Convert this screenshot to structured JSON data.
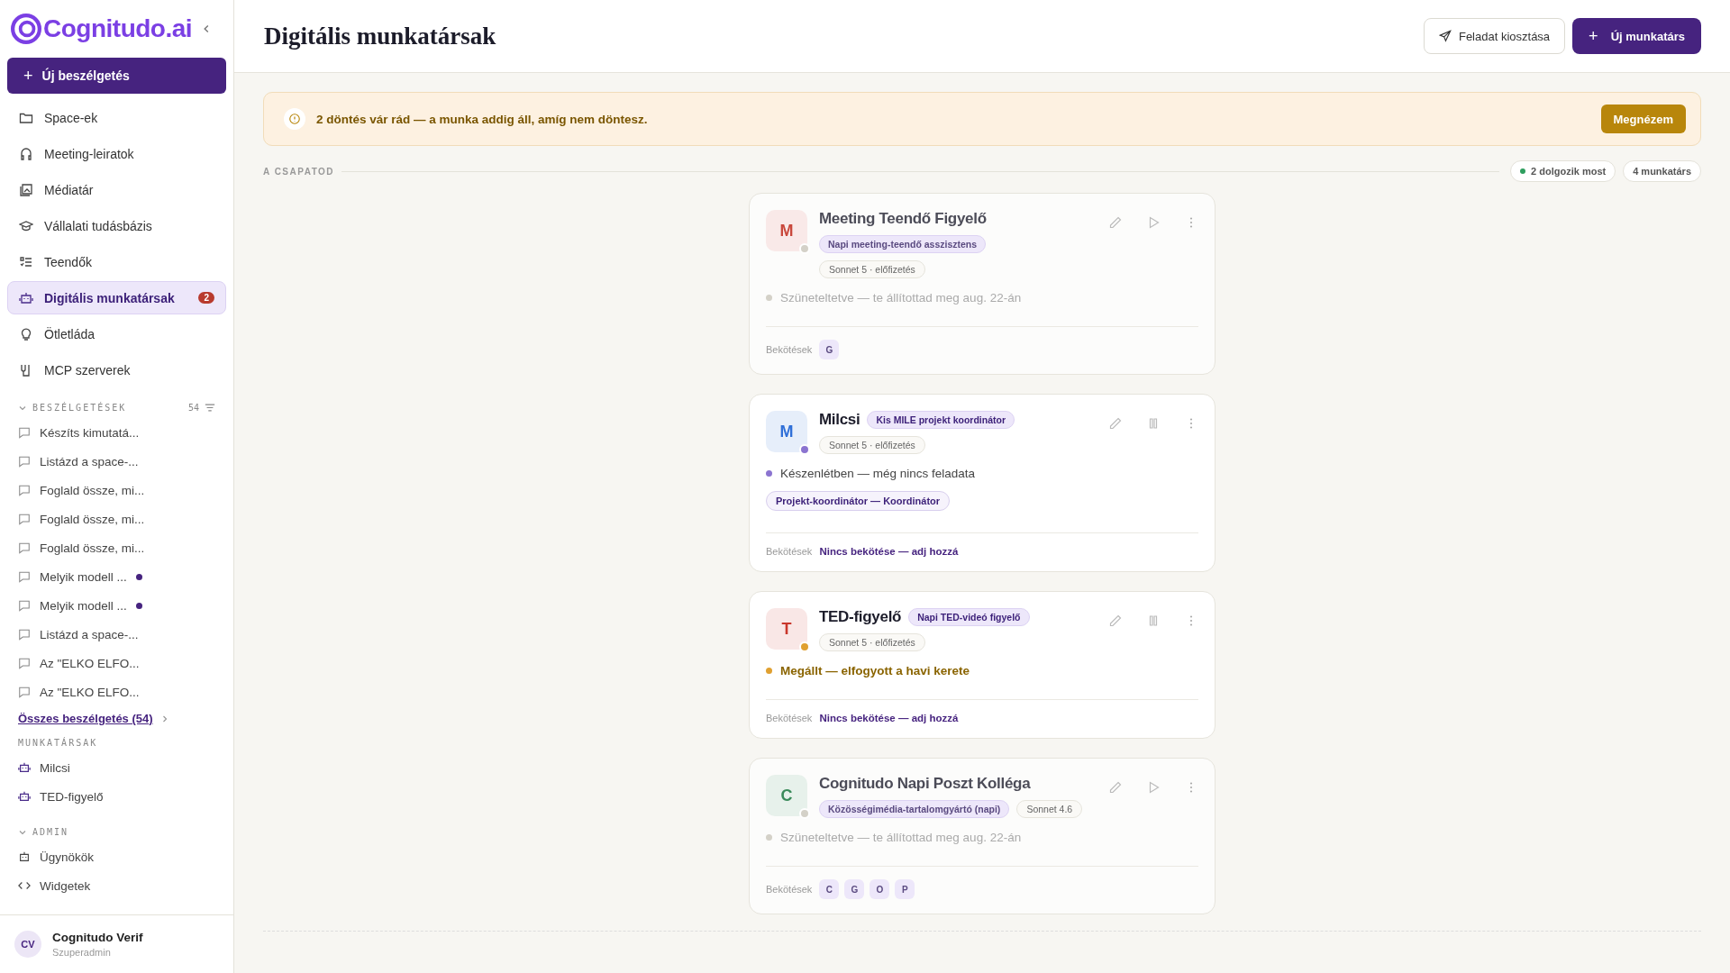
{
  "sidebar": {
    "brand": "Cognitudo.ai",
    "new_chat": "Új beszélgetés",
    "nav": [
      {
        "label": "Space-ek",
        "selected": false
      },
      {
        "label": "Meeting-leiratok",
        "selected": false
      },
      {
        "label": "Médiatár",
        "selected": false
      },
      {
        "label": "Vállalati tudásbázis",
        "selected": false
      },
      {
        "label": "Teendők",
        "selected": false
      },
      {
        "label": "Digitális munkatársak",
        "selected": true,
        "badge": "2"
      },
      {
        "label": "Ötletláda",
        "selected": false
      },
      {
        "label": "MCP szerverek",
        "selected": false
      }
    ],
    "conversations": {
      "title": "BESZÉLGETÉSEK",
      "count": "54",
      "expanded": true,
      "items": [
        {
          "label": "Készíts kimutatá...",
          "unread": false
        },
        {
          "label": "Listázd a space-...",
          "unread": false
        },
        {
          "label": "Foglald össze, mi...",
          "unread": false
        },
        {
          "label": "Foglald össze, mi...",
          "unread": false
        },
        {
          "label": "Foglald össze, mi...",
          "unread": false
        },
        {
          "label": "Melyik modell ...",
          "unread": true
        },
        {
          "label": "Melyik modell ...",
          "unread": true
        },
        {
          "label": "Listázd a space-...",
          "unread": false
        },
        {
          "label": "Az \"ELKO ELFO...",
          "unread": false
        },
        {
          "label": "Az \"ELKO ELFO...",
          "unread": false
        }
      ],
      "all_link": "Összes beszélgetés (54)"
    },
    "new_chat_icon": "+",
    "coworkers": {
      "title": "MUNKATÁRSAK",
      "items": [
        "Milcsi",
        "TED-figyelő"
      ]
    },
    "admin": {
      "title": "ADMIN",
      "expanded": true,
      "items": [
        {
          "label": "Ügynökök"
        },
        {
          "label": "Widgetek"
        }
      ]
    },
    "user": {
      "initials": "CV",
      "name": "Cognitudo Verif",
      "role": "Szuperadmin"
    }
  },
  "header": {
    "title": "Digitális munkatársak",
    "assign_button": "Feladat kiosztása",
    "new_icon": "+",
    "new_button": "Új munkatárs"
  },
  "alert": {
    "text": "2 döntés vár rád — a munka addig áll, amíg nem döntesz.",
    "button": "Megnézem"
  },
  "team": {
    "title": "A CSAPATOD",
    "working": "2 dolgozik most",
    "total": "4 munkatárs",
    "cards": [
      {
        "kind": "stacked",
        "avatar": {
          "initial": "M",
          "color": "#c9483c"
        },
        "name": "Meeting Teendő Figyelő",
        "paused": true,
        "role": "Napi meeting-teendő asszisztens",
        "models": [
          "Sonnet 5 · előfizetés"
        ],
        "status": {
          "kind": "paused",
          "color": "#d4d1c8",
          "text": "Szüneteltetve — te állítottad meg aug. 22-án"
        },
        "bindings_label": "Bekötések",
        "bindings": [
          "G"
        ]
      },
      {
        "kind": "inline",
        "avatar": {
          "initial": "M",
          "color": "#2f6fd8"
        },
        "name": "Milcsi",
        "paused": false,
        "role": "Kis MILE projekt koordinátor",
        "models": [
          "Sonnet 5 · előfizetés"
        ],
        "status": {
          "kind": "idle",
          "color": "#8b74d0",
          "text": "Készenlétben — még nincs feladata"
        },
        "skill": "Projekt-koordinátor — Koordinátor",
        "bindings_label": "Bekötések",
        "bindings_link": "Nincs bekötése — adj hozzá"
      },
      {
        "kind": "inline",
        "avatar": {
          "initial": "T",
          "color": "#c9372c"
        },
        "name": "TED-figyelő",
        "paused": false,
        "role": "Napi TED-videó figyelő",
        "models": [
          "Sonnet 5 · előfizetés"
        ],
        "status": {
          "kind": "stopped",
          "color": "#e0a030",
          "text": "Megállt — elfogyott a havi kerete"
        },
        "bindings_label": "Bekötések",
        "bindings_link": "Nincs bekötése — adj hozzá"
      },
      {
        "kind": "compact",
        "avatar": {
          "initial": "C",
          "color": "#3a8a5a"
        },
        "name": "Cognitudo Napi Poszt Kolléga",
        "paused": true,
        "role": "Közösségimédia-tartalomgyártó (napi)",
        "models": [
          "Sonnet 4.6"
        ],
        "status": {
          "kind": "paused",
          "color": "#d4d1c8",
          "text": "Szüneteltetve — te állítottad meg aug. 22-án"
        },
        "bindings_label": "Bekötések",
        "bindings": [
          "C",
          "G",
          "O",
          "P"
        ]
      }
    ]
  }
}
